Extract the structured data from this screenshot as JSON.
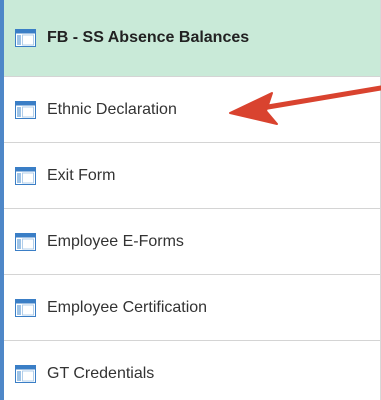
{
  "menu": {
    "items": [
      {
        "label": "FB - SS Absence Balances",
        "icon": "window-icon",
        "selected": true
      },
      {
        "label": "Ethnic Declaration",
        "icon": "window-icon"
      },
      {
        "label": "Exit Form",
        "icon": "window-icon"
      },
      {
        "label": "Employee E-Forms",
        "icon": "window-icon"
      },
      {
        "label": "Employee Certification",
        "icon": "window-icon"
      },
      {
        "label": "GT Credentials",
        "icon": "window-icon"
      }
    ]
  },
  "colors": {
    "selected_background": "#c9ead8",
    "left_accent": "#4e87c8",
    "icon_blue": "#3a7ec6",
    "annotation_arrow": "#d9432f"
  }
}
